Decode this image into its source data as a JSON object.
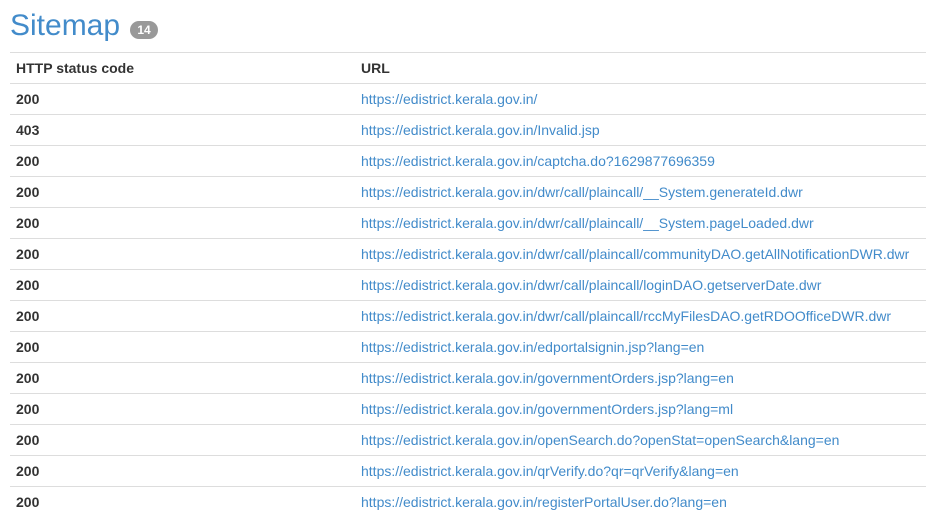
{
  "header": {
    "title": "Sitemap",
    "count_badge": "14"
  },
  "table": {
    "columns": [
      "HTTP status code",
      "URL"
    ],
    "rows": [
      {
        "status": "200",
        "url": "https://edistrict.kerala.gov.in/"
      },
      {
        "status": "403",
        "url": "https://edistrict.kerala.gov.in/Invalid.jsp"
      },
      {
        "status": "200",
        "url": "https://edistrict.kerala.gov.in/captcha.do?1629877696359"
      },
      {
        "status": "200",
        "url": "https://edistrict.kerala.gov.in/dwr/call/plaincall/__System.generateId.dwr"
      },
      {
        "status": "200",
        "url": "https://edistrict.kerala.gov.in/dwr/call/plaincall/__System.pageLoaded.dwr"
      },
      {
        "status": "200",
        "url": "https://edistrict.kerala.gov.in/dwr/call/plaincall/communityDAO.getAllNotificationDWR.dwr"
      },
      {
        "status": "200",
        "url": "https://edistrict.kerala.gov.in/dwr/call/plaincall/loginDAO.getserverDate.dwr"
      },
      {
        "status": "200",
        "url": "https://edistrict.kerala.gov.in/dwr/call/plaincall/rccMyFilesDAO.getRDOOfficeDWR.dwr"
      },
      {
        "status": "200",
        "url": "https://edistrict.kerala.gov.in/edportalsignin.jsp?lang=en"
      },
      {
        "status": "200",
        "url": "https://edistrict.kerala.gov.in/governmentOrders.jsp?lang=en"
      },
      {
        "status": "200",
        "url": "https://edistrict.kerala.gov.in/governmentOrders.jsp?lang=ml"
      },
      {
        "status": "200",
        "url": "https://edistrict.kerala.gov.in/openSearch.do?openStat=openSearch&lang=en"
      },
      {
        "status": "200",
        "url": "https://edistrict.kerala.gov.in/qrVerify.do?qr=qrVerify&lang=en"
      },
      {
        "status": "200",
        "url": "https://edistrict.kerala.gov.in/registerPortalUser.do?lang=en"
      }
    ]
  },
  "colors": {
    "accent": "#428bca",
    "badge_bg": "#999999",
    "text": "#333333",
    "border": "#dddddd"
  }
}
